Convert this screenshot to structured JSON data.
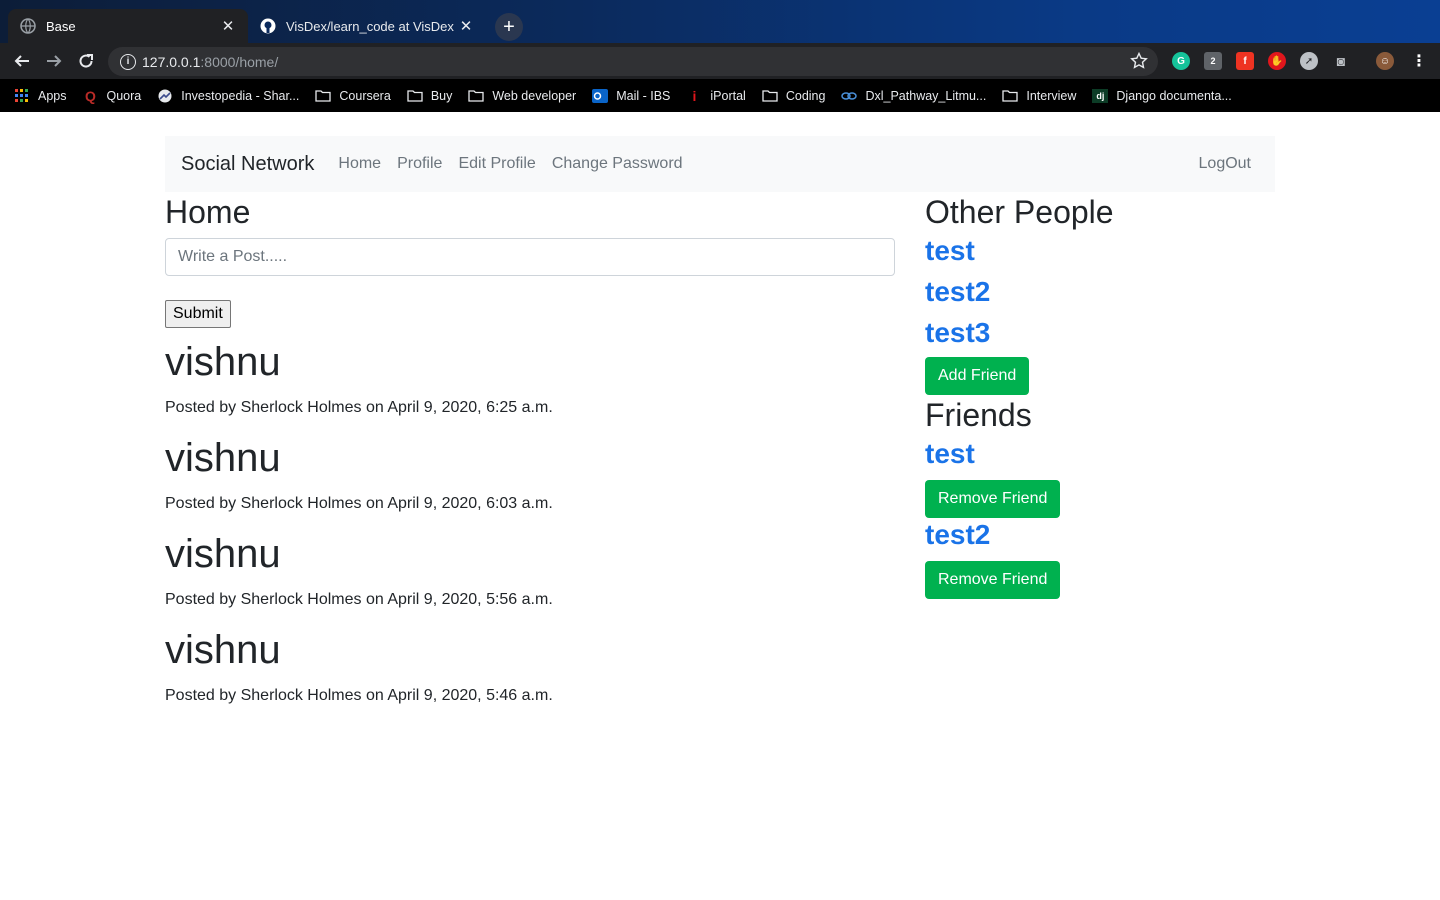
{
  "browser": {
    "tabs": [
      {
        "title": "Base",
        "icon": "globe-icon",
        "active": true
      },
      {
        "title": "VisDex/learn_code at VisDex",
        "icon": "github-icon",
        "active": false
      }
    ],
    "address": {
      "host": "127.0.0.1",
      "path": ":8000/home/"
    },
    "bookmarks": [
      {
        "label": "Apps",
        "icon": "apps-grid-icon"
      },
      {
        "label": "Quora",
        "icon": "quora-icon"
      },
      {
        "label": "Investopedia - Shar...",
        "icon": "investopedia-icon"
      },
      {
        "label": "Coursera",
        "icon": "folder-icon"
      },
      {
        "label": "Buy",
        "icon": "folder-icon"
      },
      {
        "label": "Web developer",
        "icon": "folder-icon"
      },
      {
        "label": "Mail - IBS",
        "icon": "outlook-icon"
      },
      {
        "label": "iPortal",
        "icon": "iportal-icon"
      },
      {
        "label": "Coding",
        "icon": "folder-icon"
      },
      {
        "label": "Dxl_Pathway_Litmu...",
        "icon": "dxl-icon"
      },
      {
        "label": "Interview",
        "icon": "folder-icon"
      },
      {
        "label": "Django documenta...",
        "icon": "django-icon"
      }
    ],
    "extension_badge": "2"
  },
  "navbar": {
    "brand": "Social Network",
    "links": [
      "Home",
      "Profile",
      "Edit Profile",
      "Change Password"
    ],
    "logout": "LogOut"
  },
  "main": {
    "heading": "Home",
    "post_placeholder": "Write a Post.....",
    "submit_label": "Submit",
    "posts": [
      {
        "title": "vishnu",
        "meta": "Posted by Sherlock Holmes on April 9, 2020, 6:25 a.m."
      },
      {
        "title": "vishnu",
        "meta": "Posted by Sherlock Holmes on April 9, 2020, 6:03 a.m."
      },
      {
        "title": "vishnu",
        "meta": "Posted by Sherlock Holmes on April 9, 2020, 5:56 a.m."
      },
      {
        "title": "vishnu",
        "meta": "Posted by Sherlock Holmes on April 9, 2020, 5:46 a.m."
      }
    ]
  },
  "sidebar": {
    "other_heading": "Other People",
    "other_people": [
      "test",
      "test2",
      "test3"
    ],
    "add_friend_label": "Add Friend",
    "friends_heading": "Friends",
    "friends": [
      {
        "name": "test",
        "button": "Remove Friend"
      },
      {
        "name": "test2",
        "button": "Remove Friend"
      }
    ]
  },
  "colors": {
    "link": "#1a73e8",
    "button": "#00b14f",
    "navbar_bg": "#f8f9fa"
  }
}
